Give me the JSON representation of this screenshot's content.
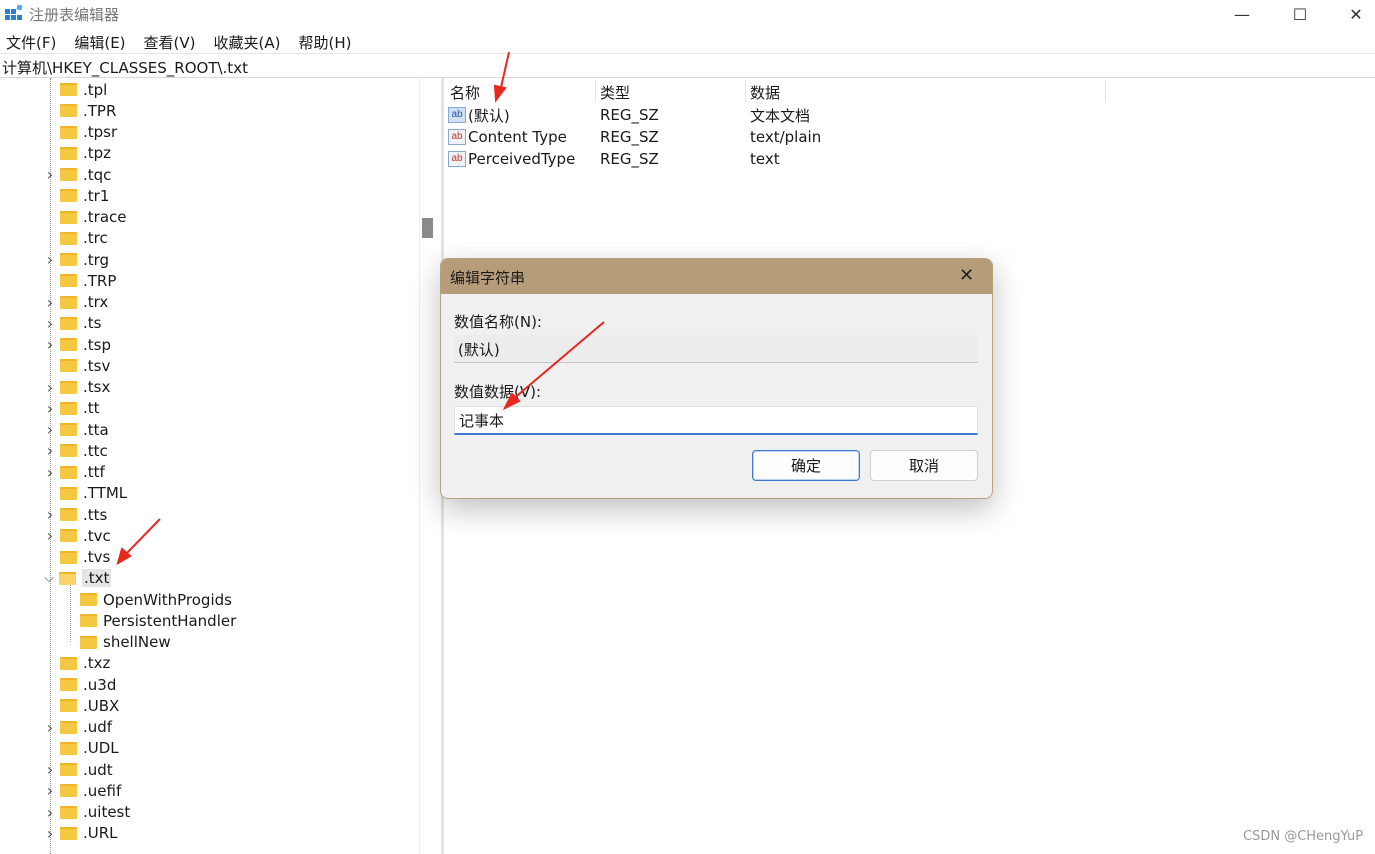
{
  "window": {
    "title": "注册表编辑器",
    "minimize_glyph": "—",
    "maximize_glyph": "☐",
    "close_glyph": "✕"
  },
  "menu": [
    "文件(F)",
    "编辑(E)",
    "查看(V)",
    "收藏夹(A)",
    "帮助(H)"
  ],
  "address": "计算机\\HKEY_CLASSES_ROOT\\.txt",
  "tree": {
    "items": [
      {
        "label": ".tpl",
        "expandable": false
      },
      {
        "label": ".TPR",
        "expandable": false
      },
      {
        "label": ".tpsr",
        "expandable": false
      },
      {
        "label": ".tpz",
        "expandable": false
      },
      {
        "label": ".tqc",
        "expandable": true
      },
      {
        "label": ".tr1",
        "expandable": false
      },
      {
        "label": ".trace",
        "expandable": false
      },
      {
        "label": ".trc",
        "expandable": false
      },
      {
        "label": ".trg",
        "expandable": true
      },
      {
        "label": ".TRP",
        "expandable": false
      },
      {
        "label": ".trx",
        "expandable": true
      },
      {
        "label": ".ts",
        "expandable": true
      },
      {
        "label": ".tsp",
        "expandable": true
      },
      {
        "label": ".tsv",
        "expandable": false
      },
      {
        "label": ".tsx",
        "expandable": true
      },
      {
        "label": ".tt",
        "expandable": true
      },
      {
        "label": ".tta",
        "expandable": true
      },
      {
        "label": ".ttc",
        "expandable": true
      },
      {
        "label": ".ttf",
        "expandable": true
      },
      {
        "label": ".TTML",
        "expandable": false
      },
      {
        "label": ".tts",
        "expandable": true
      },
      {
        "label": ".tvc",
        "expandable": true
      },
      {
        "label": ".tvs",
        "expandable": false
      },
      {
        "label": ".txt",
        "expandable": true,
        "expanded": true,
        "selected": true
      },
      {
        "label": "OpenWithProgids",
        "child": true
      },
      {
        "label": "PersistentHandler",
        "child": true
      },
      {
        "label": "shellNew",
        "child": true
      },
      {
        "label": ".txz",
        "expandable": false
      },
      {
        "label": ".u3d",
        "expandable": false
      },
      {
        "label": ".UBX",
        "expandable": false
      },
      {
        "label": ".udf",
        "expandable": true
      },
      {
        "label": ".UDL",
        "expandable": false
      },
      {
        "label": ".udt",
        "expandable": true
      },
      {
        "label": ".uefif",
        "expandable": true
      },
      {
        "label": ".uitest",
        "expandable": true
      },
      {
        "label": ".URL",
        "expandable": true
      }
    ]
  },
  "values": {
    "columns": [
      "名称",
      "类型",
      "数据"
    ],
    "rows": [
      {
        "name": "(默认)",
        "type": "REG_SZ",
        "data": "文本文档",
        "icon": "ab"
      },
      {
        "name": "Content Type",
        "type": "REG_SZ",
        "data": "text/plain",
        "icon": "ab"
      },
      {
        "name": "PerceivedType",
        "type": "REG_SZ",
        "data": "text",
        "icon": "ab"
      }
    ]
  },
  "dialog": {
    "title": "编辑字符串",
    "close_glyph": "✕",
    "name_label": "数值名称(N):",
    "name_value": "(默认)",
    "data_label": "数值数据(V):",
    "data_value": "记事本",
    "ok_label": "确定",
    "cancel_label": "取消"
  },
  "watermark": "CSDN @CHengYuP",
  "colors": {
    "dialog_titlebar": "#b79c7a",
    "focus_accent": "#3d7bd0",
    "annotation_arrow": "#e8281f",
    "folder": "#f5c842"
  }
}
